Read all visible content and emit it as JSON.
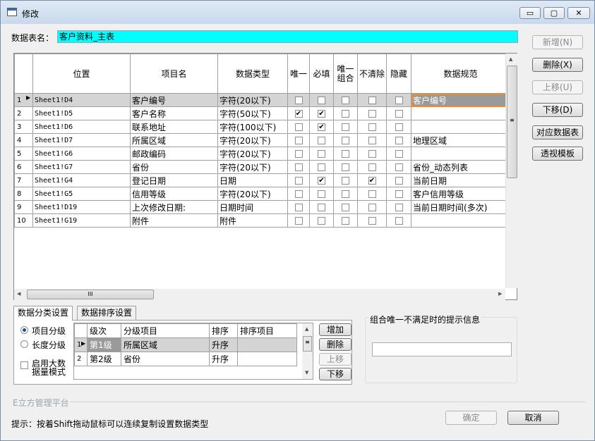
{
  "window": {
    "title": "修改",
    "min_icon": "▭",
    "max_icon": "▢",
    "close_icon": "✕"
  },
  "table_name": {
    "label": "数据表名：",
    "value": "客户资料_主表"
  },
  "side_buttons": {
    "add": "新增(N)",
    "delete": "删除(X)",
    "up": "上移(U)",
    "down": "下移(D)",
    "map_table": "对应数据表",
    "pivot": "透视模板"
  },
  "grid": {
    "headers": [
      "位置",
      "项目名",
      "数据类型",
      "唯一",
      "必填",
      "唯一组合",
      "不清除",
      "隐藏",
      "数据规范"
    ],
    "rows": [
      {
        "n": "1",
        "pos": "Sheet1!D4",
        "name": "客户编号",
        "type": "字符(20以下)",
        "c": [
          "",
          "",
          "",
          "",
          ""
        ],
        "rule": "客户编号"
      },
      {
        "n": "2",
        "pos": "Sheet1!D5",
        "name": "客户名称",
        "type": "字符(50以下)",
        "c": [
          "✔",
          "✔",
          "",
          "",
          ""
        ],
        "rule": ""
      },
      {
        "n": "3",
        "pos": "Sheet1!D6",
        "name": "联系地址",
        "type": "字符(100以下)",
        "c": [
          "",
          "✔",
          "",
          "",
          ""
        ],
        "rule": ""
      },
      {
        "n": "4",
        "pos": "Sheet1!D7",
        "name": "所属区域",
        "type": "字符(20以下)",
        "c": [
          "",
          "",
          "",
          "",
          ""
        ],
        "rule": "地理区域"
      },
      {
        "n": "5",
        "pos": "Sheet1!G6",
        "name": "邮政编码",
        "type": "字符(20以下)",
        "c": [
          "",
          "",
          "",
          "",
          ""
        ],
        "rule": ""
      },
      {
        "n": "6",
        "pos": "Sheet1!G7",
        "name": "省份",
        "type": "字符(20以下)",
        "c": [
          "",
          "",
          "",
          "",
          ""
        ],
        "rule": "省份_动态列表"
      },
      {
        "n": "7",
        "pos": "Sheet1!G4",
        "name": "登记日期",
        "type": "日期",
        "c": [
          "",
          "✔",
          "",
          "✔",
          ""
        ],
        "rule": "当前日期"
      },
      {
        "n": "8",
        "pos": "Sheet1!G5",
        "name": "信用等级",
        "type": "字符(20以下)",
        "c": [
          "",
          "",
          "",
          "",
          ""
        ],
        "rule": "客户信用等级"
      },
      {
        "n": "9",
        "pos": "Sheet1!D19",
        "name": "上次修改日期:",
        "type": "日期时间",
        "c": [
          "",
          "",
          "",
          "",
          ""
        ],
        "rule": "当前日期时间(多次)"
      },
      {
        "n": "10",
        "pos": "Sheet1!G19",
        "name": "附件",
        "type": "附件",
        "c": [
          "",
          "",
          "",
          "",
          ""
        ],
        "rule": ""
      }
    ],
    "hscroll_grip": "III"
  },
  "tabs": {
    "classify": "数据分类设置",
    "sort": "数据排序设置"
  },
  "classify": {
    "radio_item": "项目分级",
    "radio_length": "长度分级",
    "big_data": "启用大数据量模式",
    "headers": [
      "级次",
      "分级项目",
      "排序",
      "排序项目"
    ],
    "rows": [
      {
        "n": "1",
        "level": "第1级",
        "item": "所属区域",
        "order": "升序",
        "order_item": ""
      },
      {
        "n": "2",
        "level": "第2级",
        "item": "省份",
        "order": "升序",
        "order_item": ""
      }
    ],
    "buttons": {
      "add": "增加",
      "delete": "删除",
      "up": "上移",
      "down": "下移"
    },
    "grip": "≡"
  },
  "combo_group": {
    "title": "组合唯一不满足时的提示信息",
    "value": ""
  },
  "footer": {
    "brand": "E立方管理平台",
    "tip": "提示：按着Shift拖动鼠标可以连续复制设置数据类型",
    "ok": "确定",
    "cancel": "取消"
  }
}
